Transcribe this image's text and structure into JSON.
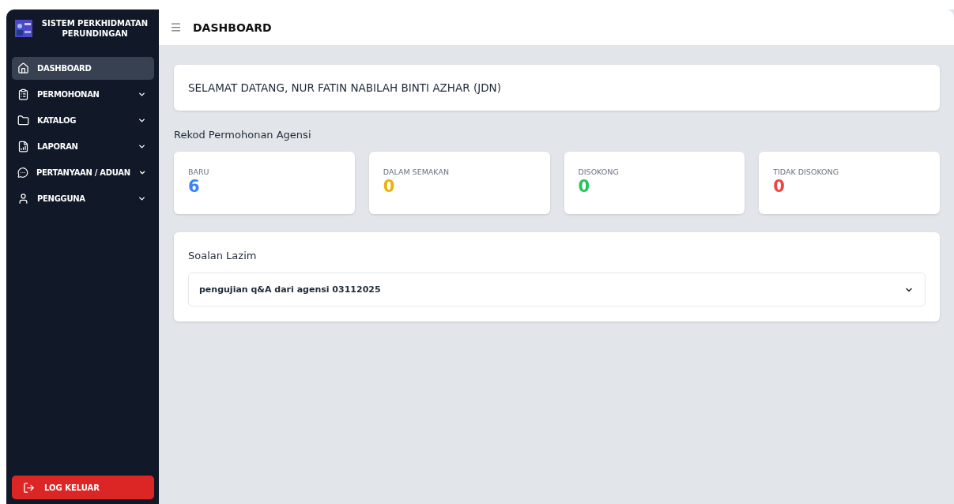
{
  "sidebar": {
    "title": "SISTEM PERKHIDMATAN PERUNDINGAN",
    "items": [
      {
        "label": "DASHBOARD",
        "selected": true,
        "expandable": false
      },
      {
        "label": "PERMOHONAN",
        "selected": false,
        "expandable": true
      },
      {
        "label": "KATALOG",
        "selected": false,
        "expandable": true
      },
      {
        "label": "LAPORAN",
        "selected": false,
        "expandable": true
      },
      {
        "label": "PERTANYAAN / ADUAN",
        "selected": false,
        "expandable": true
      },
      {
        "label": "PENGGUNA",
        "selected": false,
        "expandable": true
      }
    ],
    "logout": "LOG KELUAR"
  },
  "header": {
    "title": "DASHBOARD"
  },
  "welcome": "SELAMAT DATANG, NUR FATIN NABILAH BINTI AZHAR (JDN)",
  "stats_title": "Rekod Permohonan Agensi",
  "stats": [
    {
      "label": "BARU",
      "value": "6",
      "color": "#3b82f6"
    },
    {
      "label": "DALAM SEMAKAN",
      "value": "0",
      "color": "#eab308"
    },
    {
      "label": "DISOKONG",
      "value": "0",
      "color": "#22c55e"
    },
    {
      "label": "TIDAK DISOKONG",
      "value": "0",
      "color": "#ef4444"
    }
  ],
  "faq": {
    "title": "Soalan Lazim",
    "items": [
      {
        "question": "pengujian q&A dari agensi 03112025",
        "expanded": false
      }
    ]
  }
}
